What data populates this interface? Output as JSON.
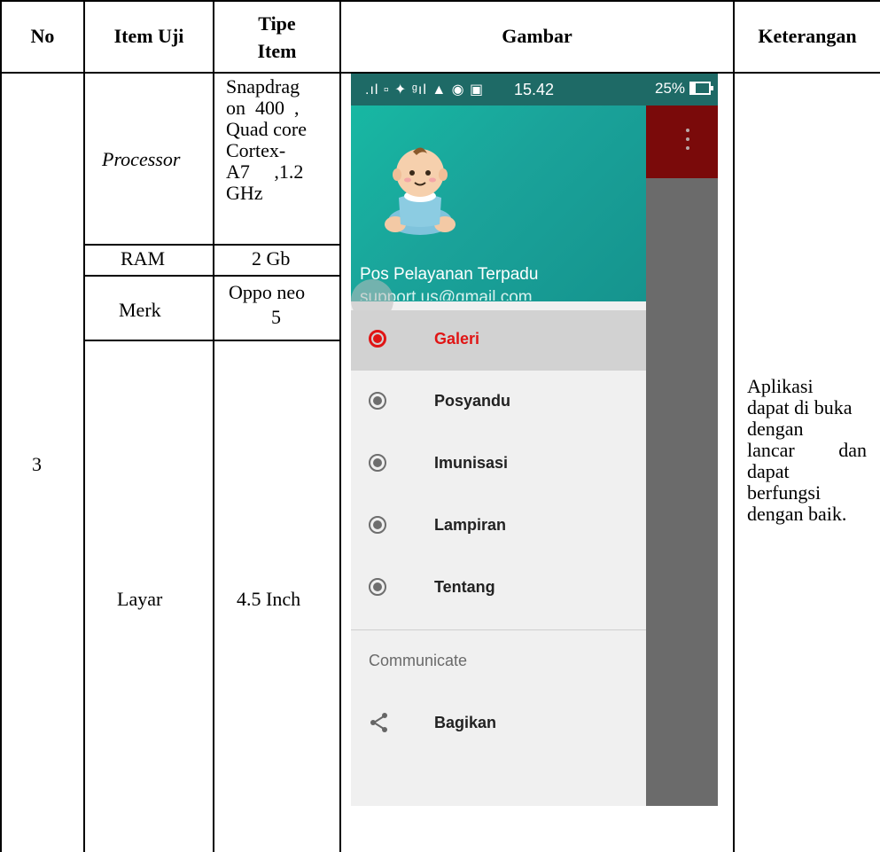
{
  "table": {
    "headers": {
      "no": "No",
      "item_uji": "Item Uji",
      "tipe_item_line1": "Tipe",
      "tipe_item_line2": "Item",
      "gambar": "Gambar",
      "keterangan": "Keterangan"
    },
    "row": {
      "no": "3",
      "items": [
        {
          "name": "Processor",
          "type_lines": [
            "Snapdrag",
            "on  400  ,",
            "Quad core",
            "Cortex-",
            "A7     ,1.2",
            "GHz"
          ]
        },
        {
          "name": "RAM",
          "type_lines": [
            "2 Gb"
          ]
        },
        {
          "name": "Merk",
          "type_lines": [
            "Oppo neo",
            "5"
          ]
        },
        {
          "name": "Layar",
          "type_lines": [
            "4.5 Inch"
          ]
        }
      ],
      "keterangan_lines": [
        "Aplikasi",
        "dapat di buka",
        "dengan",
        "lancar         dan",
        "dapat",
        "berfungsi",
        "dengan baik."
      ]
    }
  },
  "phone": {
    "status_icons": ".ıl ▫ ✦ ᵍıl ▲ ◉ ▣",
    "time": "15.42",
    "battery": "25%",
    "battery_level": 0.25,
    "header": {
      "app_name": "Pos Pelayanan Terpadu",
      "email": "support.us@gmail.com"
    },
    "menu": [
      {
        "label": "Galeri",
        "active": true,
        "icon": "radio-icon"
      },
      {
        "label": "Posyandu",
        "active": false,
        "icon": "radio-icon"
      },
      {
        "label": "Imunisasi",
        "active": false,
        "icon": "radio-icon"
      },
      {
        "label": "Lampiran",
        "active": false,
        "icon": "radio-icon"
      },
      {
        "label": "Tentang",
        "active": false,
        "icon": "radio-icon"
      }
    ],
    "section": "Communicate",
    "share": {
      "label": "Bagikan",
      "icon": "share-icon"
    },
    "colors": {
      "header_teal": "#17b8a3",
      "active_red": "#e01515",
      "appbar_dark_red": "#7a0a0a"
    }
  }
}
